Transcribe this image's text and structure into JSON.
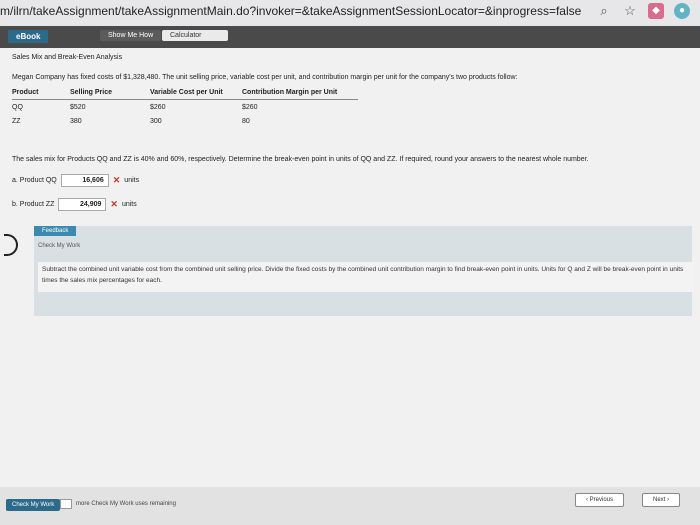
{
  "browser": {
    "url": "m/ilrn/takeAssignment/takeAssignmentMain.do?invoker=&takeAssignmentSessionLocator=&inprogress=false",
    "icons": [
      "search-icon",
      "star-icon",
      "extension-icon",
      "extension-icon"
    ]
  },
  "toolbar": {
    "ebook_label": "eBook",
    "show_me_how_label": "Show Me How",
    "calculator_label": "Calculator"
  },
  "problem": {
    "heading": "Sales Mix and Break-Even Analysis",
    "intro": "Megan Company has fixed costs of $1,328,480. The unit selling price, variable cost per unit, and contribution margin per unit for the company's two products follow:",
    "table": {
      "headers": [
        "Product",
        "Selling Price",
        "Variable Cost per Unit",
        "Contribution Margin per Unit"
      ],
      "rows": [
        [
          "QQ",
          "$520",
          "$260",
          "$260"
        ],
        [
          "ZZ",
          "380",
          "300",
          "80"
        ]
      ]
    },
    "mix_text": "The sales mix for Products QQ and ZZ is 40% and 60%, respectively. Determine the break-even point in units of QQ and ZZ. If required, round your answers to the nearest whole number.",
    "answer_a": {
      "label": "a. Product QQ",
      "value": "16,606",
      "unit": "units"
    },
    "answer_b": {
      "label": "b. Product ZZ",
      "value": "24,909",
      "unit": "units"
    }
  },
  "feedback": {
    "tab": "Feedback",
    "sub": "Check My Work",
    "body": "Subtract the combined unit variable cost from the combined unit selling price. Divide the fixed costs by the combined unit contribution margin to find break-even point in units. Units for Q and Z will be break-even point in units times the sales mix percentages for each."
  },
  "bottom": {
    "check_my_work_label": "Check My Work",
    "remaining_text": "more Check My Work uses remaining",
    "previous_label": "Previous",
    "next_label": "Next"
  }
}
